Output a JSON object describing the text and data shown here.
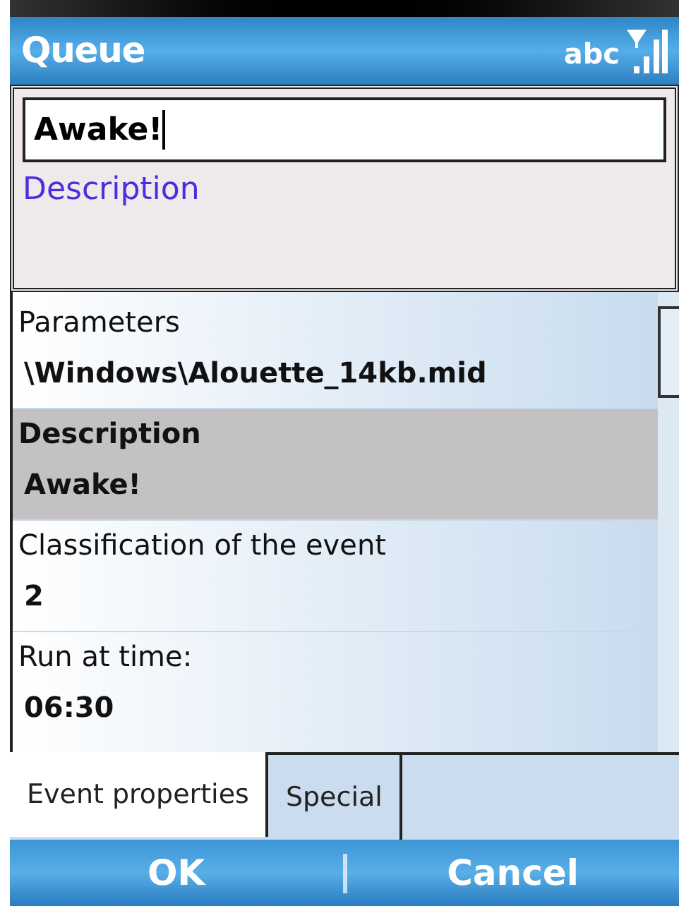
{
  "title_bar": {
    "title": "Queue",
    "input_mode": "abc"
  },
  "name_field": {
    "value": "Awake!"
  },
  "description_label": "Description",
  "properties": [
    {
      "label": "Parameters",
      "value": "\\Windows\\Alouette_14kb.mid",
      "selected": false
    },
    {
      "label": "Description",
      "value": "Awake!",
      "selected": true
    },
    {
      "label": "Classification of the event",
      "value": "2",
      "selected": false
    },
    {
      "label": "Run at time:",
      "value": "06:30",
      "selected": false
    }
  ],
  "tabs": [
    {
      "label": "Event properties",
      "selected": true
    },
    {
      "label": "Special",
      "selected": false
    }
  ],
  "softkeys": [
    "OK",
    "Cancel"
  ]
}
